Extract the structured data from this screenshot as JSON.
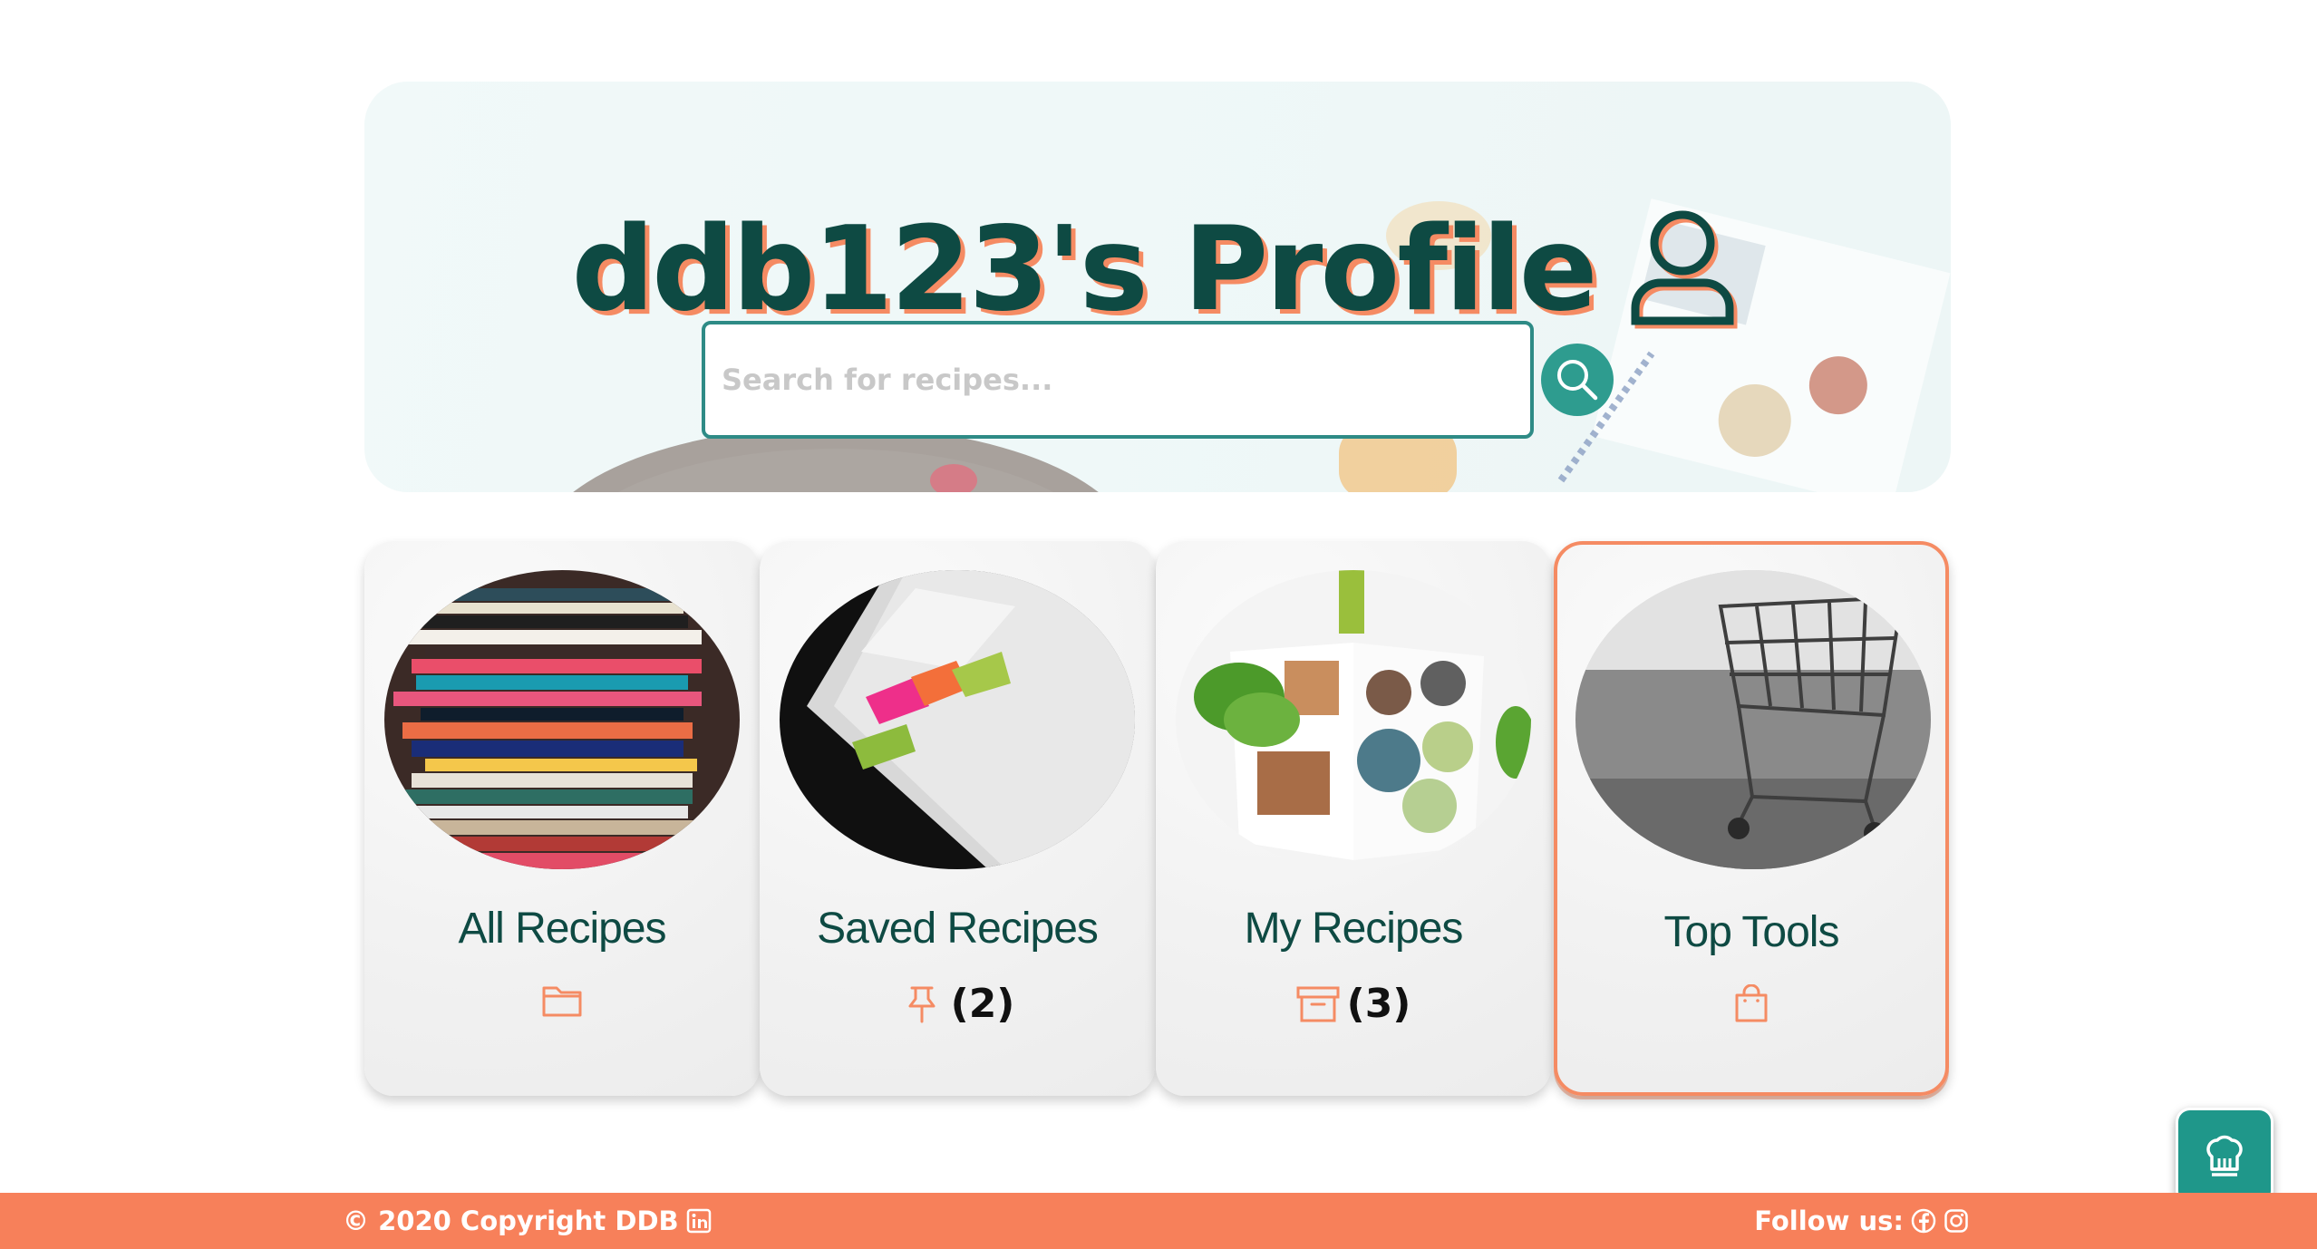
{
  "profile": {
    "title": "ddb123's Profile",
    "icon": "user-icon"
  },
  "search": {
    "placeholder": "Search for recipes...",
    "value": "",
    "button_icon": "search-icon"
  },
  "cards": [
    {
      "title": "All Recipes",
      "icon": "folder-icon",
      "count": "",
      "selected": false
    },
    {
      "title": "Saved Recipes",
      "icon": "pin-icon",
      "count": "(2)",
      "selected": false
    },
    {
      "title": "My Recipes",
      "icon": "archive-box-icon",
      "count": "(3)",
      "selected": false
    },
    {
      "title": "Top Tools",
      "icon": "shopping-bag-icon",
      "count": "",
      "selected": true
    }
  ],
  "footer": {
    "copyright": "© 2020 Copyright DDB",
    "copyright_icon": "linkedin-icon",
    "follow_label": "Follow us:",
    "social_icons": [
      "facebook-icon",
      "instagram-icon"
    ]
  },
  "floating_button": {
    "icon": "chef-hat-icon"
  },
  "colors": {
    "brand_dark_teal": "#0e4a43",
    "accent_teal": "#2e9c8f",
    "accent_coral": "#f58b63",
    "footer_bg": "#f7805a"
  }
}
